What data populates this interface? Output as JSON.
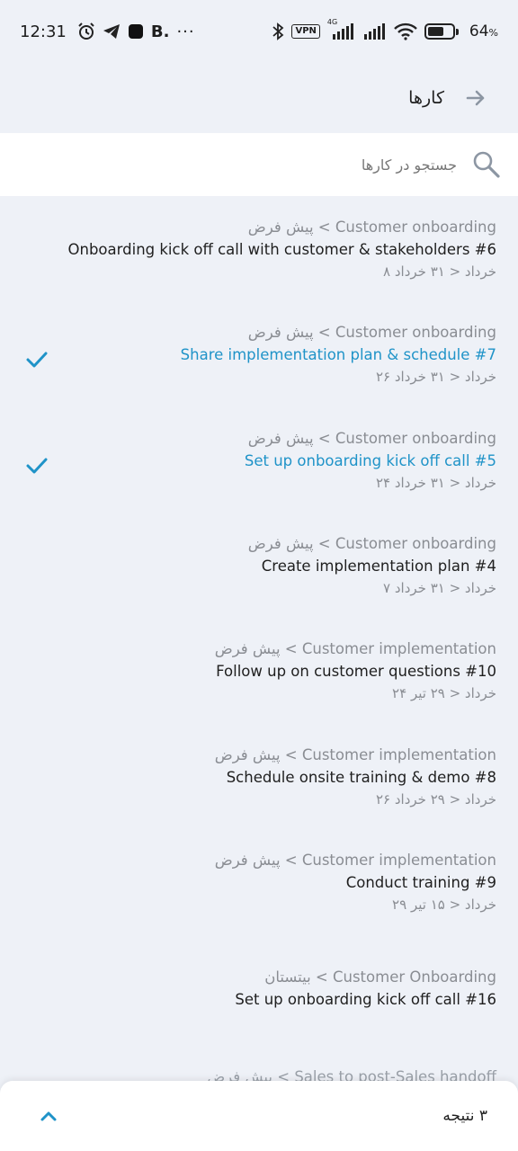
{
  "status_bar": {
    "time": "12:31",
    "left_icons": [
      "alarm-icon",
      "telegram-icon",
      "app-square-icon",
      "b-app-icon"
    ],
    "b_label": "B.",
    "more": "···",
    "vpn": "VPN",
    "network": "4G",
    "battery_percent": 64,
    "battery_text": "64",
    "battery_unit": "%"
  },
  "header": {
    "title": "کارها"
  },
  "search": {
    "placeholder": "جستجو در کارها",
    "value": ""
  },
  "colors": {
    "accent": "#1f93c8",
    "background": "#eef1f7",
    "muted_text": "#8a8d93"
  },
  "tasks": [
    {
      "path": "پیش فرض < Customer onboarding",
      "title": "Onboarding kick off call with customer & stakeholders #6",
      "dates": "۸ خرداد < ۳۱ خرداد",
      "done": false
    },
    {
      "path": "پیش فرض < Customer onboarding",
      "title": "Share implementation plan & schedule #7",
      "dates": "۲۶ خرداد < ۳۱ خرداد",
      "done": true
    },
    {
      "path": "پیش فرض < Customer onboarding",
      "title": "Set up onboarding kick off call #5",
      "dates": "۲۴ خرداد < ۳۱ خرداد",
      "done": true
    },
    {
      "path": "پیش فرض < Customer onboarding",
      "title": "Create implementation plan #4",
      "dates": "۷ خرداد < ۳۱ خرداد",
      "done": false
    },
    {
      "path": "پیش فرض < Customer implementation",
      "title": "Follow up on customer questions #10",
      "dates": "۲۴ خرداد < ۲۹ تیر",
      "done": false
    },
    {
      "path": "پیش فرض < Customer implementation",
      "title": "Schedule onsite training & demo #8",
      "dates": "۲۶ خرداد < ۲۹ خرداد",
      "done": false
    },
    {
      "path": "پیش فرض < Customer implementation",
      "title": "Conduct training #9",
      "dates": "۲۹ خرداد < ۱۵ تیر",
      "done": false
    },
    {
      "path": "بیتستان < Customer Onboarding",
      "title": "Set up onboarding kick off call #16",
      "dates": "",
      "done": false
    }
  ],
  "peek_row": "پیش فرض < Sales to post-Sales handoff",
  "bottom_sheet": {
    "result_count": "۳ نتیجه"
  }
}
